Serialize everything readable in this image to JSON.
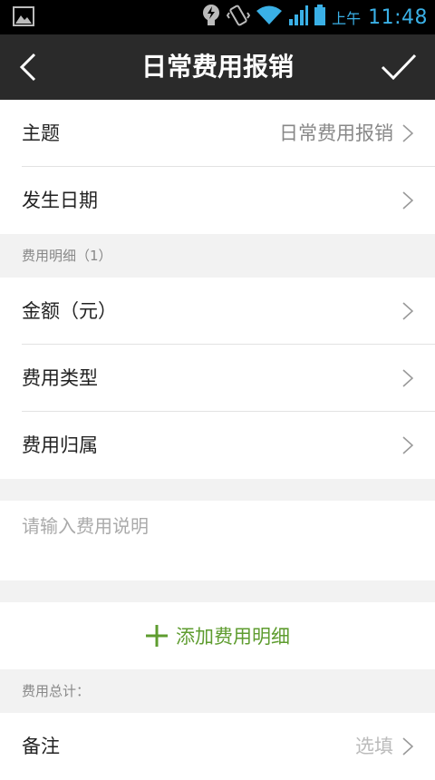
{
  "statusbar": {
    "ampm": "上午",
    "time": "11:48"
  },
  "navbar": {
    "title": "日常费用报销"
  },
  "form": {
    "subject_label": "主题",
    "subject_value": "日常费用报销",
    "date_label": "发生日期",
    "details_header": "费用明细（1）",
    "amount_label": "金额（元）",
    "type_label": "费用类型",
    "belong_label": "费用归属",
    "desc_placeholder": "请输入费用说明",
    "add_detail_label": "添加费用明细",
    "total_header": "费用总计：",
    "remark_label": "备注",
    "remark_value": "选填"
  },
  "colors": {
    "accent_green": "#5e9c2f",
    "status_blue": "#3ab0e6",
    "navbar_bg": "#2a2a2a"
  }
}
